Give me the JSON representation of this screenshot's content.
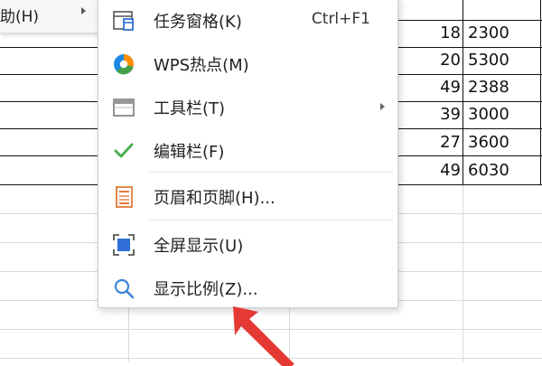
{
  "parent_menu": {
    "item_label": "助(H)"
  },
  "submenu": {
    "items": [
      {
        "label": "任务窗格(K)",
        "shortcut": "Ctrl+F1",
        "icon": "task-pane-icon"
      },
      {
        "label": "WPS热点(M)",
        "icon": "wps-hotspot-icon"
      },
      {
        "label": "工具栏(T)",
        "icon": "toolbar-icon",
        "has_submenu": true
      },
      {
        "label": "编辑栏(F)",
        "icon": "checkmark-icon",
        "checked": true
      },
      {
        "label": "页眉和页脚(H)...",
        "icon": "header-footer-icon"
      },
      {
        "label": "全屏显示(U)",
        "icon": "fullscreen-icon"
      },
      {
        "label": "显示比例(Z)...",
        "icon": "zoom-magnifier-icon"
      }
    ]
  },
  "sheet": {
    "rows": [
      {
        "a": "18",
        "b": "2300"
      },
      {
        "a": "20",
        "b": "5300"
      },
      {
        "a": "49",
        "b": "2388"
      },
      {
        "a": "39",
        "b": "3000"
      },
      {
        "a": "27",
        "b": "3600"
      },
      {
        "a": "49",
        "b": "6030"
      }
    ]
  },
  "colors": {
    "check_green": "#4caf50",
    "wps_blue": "#1e88e5",
    "wps_orange": "#ff8f00",
    "wps_green": "#43a047",
    "icon_blue": "#2f6fd6",
    "header_footer_orange": "#e07b39",
    "annotation_red": "#e53935"
  }
}
